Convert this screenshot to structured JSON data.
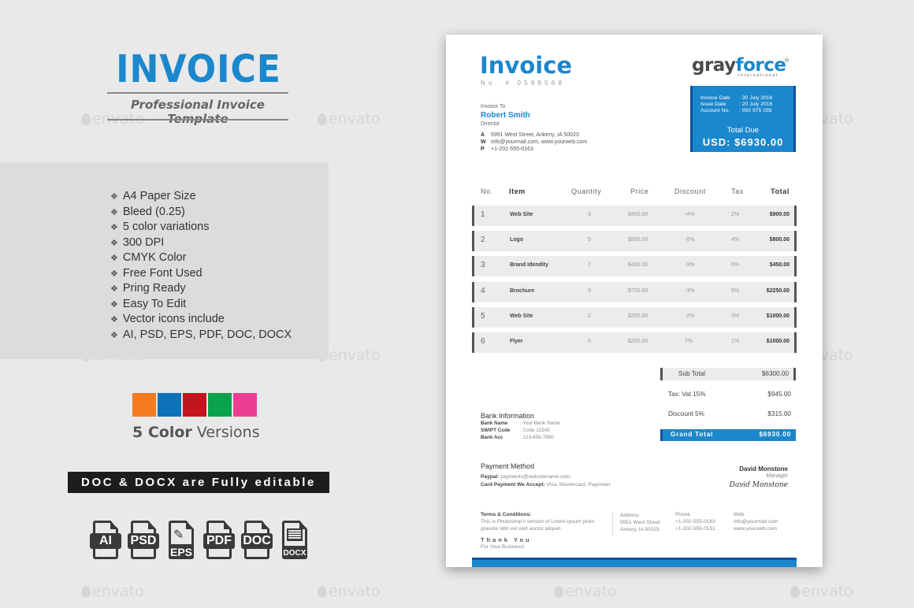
{
  "watermark": "envato",
  "left": {
    "title": "INVOICE",
    "subtitle": "Professional Invoice Template",
    "features": [
      "A4 Paper Size",
      "Bleed (0.25)",
      "5 color variations",
      "300 DPI",
      "CMYK Color",
      "Free Font Used",
      "Pring Ready",
      "Easy To Edit",
      "Vector icons include",
      "AI, PSD, EPS, PDF, DOC, DOCX"
    ],
    "bullet": "❖",
    "swatches": [
      "#f47b20",
      "#0e72bb",
      "#c3151f",
      "#0aa24b",
      "#ea3f93"
    ],
    "color_versions_bold": "5 Color",
    "color_versions_rest": " Versions",
    "editable_banner": "DOC & DOCX are Fully editable",
    "file_icons": [
      {
        "label": "AI",
        "icon": "ai-file-icon"
      },
      {
        "label": "PSD",
        "icon": "psd-file-icon"
      },
      {
        "label": "EPS",
        "icon": "eps-file-icon"
      },
      {
        "label": "PDF",
        "icon": "pdf-file-icon"
      },
      {
        "label": "DOC",
        "icon": "doc-file-icon"
      },
      {
        "label": "DOCX",
        "icon": "docx-file-icon"
      }
    ]
  },
  "invoice": {
    "title": "Invoice",
    "number": "No. # 0598568",
    "logo": {
      "gray": "gray",
      "blue": "force",
      "sub": "international",
      "reg": "®"
    },
    "meta": [
      {
        "label": "Invoice Date",
        "value": ": 30 July 2016"
      },
      {
        "label": "Issue Date",
        "value": ": 20 July 2016"
      },
      {
        "label": "Account No.",
        "value": ": 050 975 035"
      }
    ],
    "total_due_label": "Total Due",
    "total_due_value": "USD: $6930.00",
    "to_label": "Invoice To",
    "to_name": "Robert Smith",
    "to_role": "Director",
    "contacts": [
      {
        "k": "A",
        "v": "5951 West Street, Ankeny, IA 50023"
      },
      {
        "k": "W",
        "v": "info@yourmail.com, www.yourweb.com"
      },
      {
        "k": "P",
        "v": "+1-202-555-0163"
      }
    ],
    "columns": [
      "No.",
      "Item",
      "Quantity",
      "Price",
      "Discount",
      "Tax",
      "Total"
    ],
    "rows": [
      {
        "no": "1",
        "item": "Web Site",
        "qty": "3",
        "price": "$450.00",
        "disc": "-4%",
        "tax": "2%",
        "total": "$900.00"
      },
      {
        "no": "2",
        "item": "Logo",
        "qty": "5",
        "price": "$800.00",
        "disc": "-6%",
        "tax": "4%",
        "total": "$800.00"
      },
      {
        "no": "3",
        "item": "Brand Idendity",
        "qty": "7",
        "price": "$450.00",
        "disc": "-9%",
        "tax": "6%",
        "total": "$450.00"
      },
      {
        "no": "4",
        "item": "Brochure",
        "qty": "9",
        "price": "$750.00",
        "disc": "-3%",
        "tax": "9%",
        "total": "$2250.00"
      },
      {
        "no": "5",
        "item": "Web Site",
        "qty": "2",
        "price": "$250.00",
        "disc": "-2%",
        "tax": "3%",
        "total": "$1000.00"
      },
      {
        "no": "6",
        "item": "Flyer",
        "qty": "6",
        "price": "$250.00",
        "disc": "7%",
        "tax": "1%",
        "total": "$1000.00"
      }
    ],
    "summary": {
      "sub_total": {
        "label": "Sub Total",
        "value": "$6300.00"
      },
      "tax": {
        "label": "Tax: Vat 15%",
        "value": "$945.00"
      },
      "discount": {
        "label": "Discount 5%",
        "value": "$315.00"
      },
      "grand_total": {
        "label": "Grand Total",
        "value": "$6930.00"
      }
    },
    "bank": {
      "heading": "Bank Information",
      "rows": [
        {
          "k": "Bank Name",
          "v": ": Your Bank Name"
        },
        {
          "k": "SWIPT Code",
          "v": ": Code 12345"
        },
        {
          "k": "Bank Acc",
          "v": ": 123-456-7890"
        }
      ]
    },
    "payment": {
      "heading": "Payment Method",
      "paypal_label": "Paypal:",
      "paypal_value": " payments@websitename.com",
      "card_label": "Card Payment We Accept:",
      "card_value": " Visa, Mastercard, Payoneer"
    },
    "signer": {
      "name": "David Monstone",
      "role": "Manager",
      "signature": "David Monstone"
    },
    "terms": {
      "heading": "Terms & Conditions:",
      "text": "This is Photoshop's version  of Lorem Ipsum proin gravida nibh vel velit auctor aliquet."
    },
    "thank_you": "Thank You",
    "thank_sub": "For Your Business!",
    "footer": {
      "address": {
        "label": "Address",
        "line1": "5951 West Street",
        "line2": "Ankery, IA 50023"
      },
      "phone": {
        "label": "Phone",
        "line1": "+1-202-555-0163",
        "line2": "+1-202-555-0151"
      },
      "web": {
        "label": "Web",
        "line1": "info@yourmail.com",
        "line2": "www.yourweb.com"
      }
    }
  }
}
